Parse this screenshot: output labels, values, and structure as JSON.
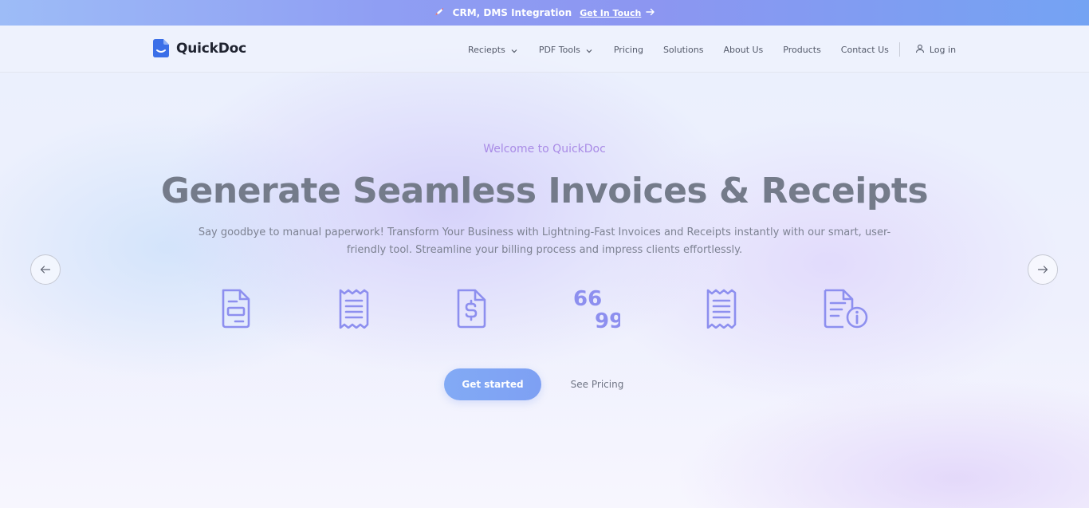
{
  "announcement": {
    "text": "CRM, DMS Integration",
    "link_label": "Get In Touch",
    "rocket_icon": "rocket-icon",
    "arrow_icon": "arrow-right-icon"
  },
  "brand": {
    "name": "QuickDoc",
    "logo_color": "#3b6fe8"
  },
  "nav": {
    "items": [
      {
        "label": "Reciepts",
        "has_dropdown": true
      },
      {
        "label": "PDF Tools",
        "has_dropdown": true
      },
      {
        "label": "Pricing",
        "has_dropdown": false
      },
      {
        "label": "Solutions",
        "has_dropdown": false
      },
      {
        "label": "About Us",
        "has_dropdown": false
      },
      {
        "label": "Products",
        "has_dropdown": false
      },
      {
        "label": "Contact Us",
        "has_dropdown": false
      }
    ],
    "login_label": "Log in",
    "login_icon": "user-icon"
  },
  "hero": {
    "eyebrow": "Welcome to QuickDoc",
    "headline": "Generate Seamless Invoices & Receipts",
    "subtext": "Say goodbye to manual paperwork! Transform Your Business with Lightning-Fast Invoices and Receipts instantly with our smart, user-friendly tool. Streamline your billing process and impress clients effortlessly.",
    "primary_cta": "Get started",
    "secondary_cta": "See Pricing",
    "feature_icons": [
      "invoice-document-icon",
      "receipt-icon",
      "dollar-document-icon",
      "quote-icon",
      "receipt-icon",
      "document-info-icon"
    ],
    "icon_color": "#8d8fef",
    "accent_color": "#a98be6"
  },
  "carousel": {
    "prev_icon": "arrow-left-icon",
    "next_icon": "arrow-right-icon"
  }
}
